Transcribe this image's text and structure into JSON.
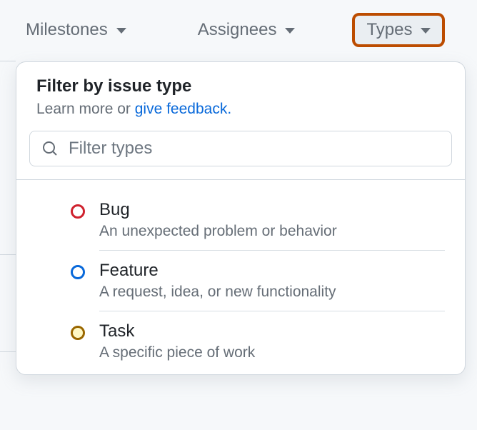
{
  "filters": {
    "milestones": "Milestones",
    "assignees": "Assignees",
    "types": "Types"
  },
  "dropdown": {
    "title": "Filter by issue type",
    "subtitle_prefix": "Learn more or ",
    "subtitle_link": "give feedback.",
    "search_placeholder": "Filter types"
  },
  "types": [
    {
      "name": "Bug",
      "desc": "An unexpected problem or behavior",
      "color": "red"
    },
    {
      "name": "Feature",
      "desc": "A request, idea, or new functionality",
      "color": "blue"
    },
    {
      "name": "Task",
      "desc": "A specific piece of work",
      "color": "yellow"
    }
  ]
}
